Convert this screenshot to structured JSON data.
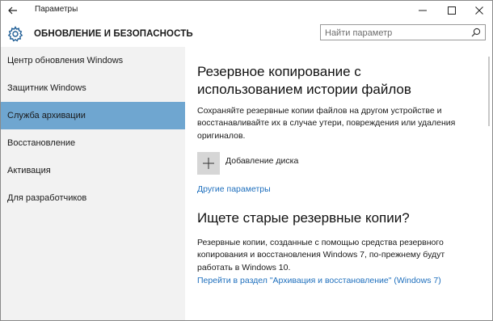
{
  "window": {
    "title": "Параметры"
  },
  "header": {
    "title": "ОБНОВЛЕНИЕ И БЕЗОПАСНОСТЬ",
    "search_placeholder": "Найти параметр"
  },
  "sidebar": {
    "items": [
      {
        "label": "Центр обновления Windows",
        "selected": false
      },
      {
        "label": "Защитник Windows",
        "selected": false
      },
      {
        "label": "Служба архивации",
        "selected": true
      },
      {
        "label": "Восстановление",
        "selected": false
      },
      {
        "label": "Активация",
        "selected": false
      },
      {
        "label": "Для разработчиков",
        "selected": false
      }
    ]
  },
  "main": {
    "heading_line1": "Резервное копирование с",
    "heading_line2": "использованием истории файлов",
    "desc_line1": "Сохраняйте резервные копии файлов на другом устройстве и",
    "desc_line2": "восстанавливайте их в случае утери, повреждения или удаления",
    "desc_line3": "оригиналов.",
    "add_drive_label": "Добавление диска",
    "more_options_link": "Другие параметры",
    "old_backups_heading": "Ищете старые резервные копии?",
    "old_desc_line1": "Резервные копии, созданные с помощью средства резервного",
    "old_desc_line2": "копирования и восстановления Windows 7, по-прежнему будут",
    "old_desc_line3": "работать в Windows 10.",
    "backup_restore_link": "Перейти в раздел \"Архивация и восстановление\" (Windows 7)"
  },
  "colors": {
    "accent_selected": "#6fa6d0",
    "link": "#1e6fbd",
    "sidebar_bg": "#f2f2f2"
  }
}
